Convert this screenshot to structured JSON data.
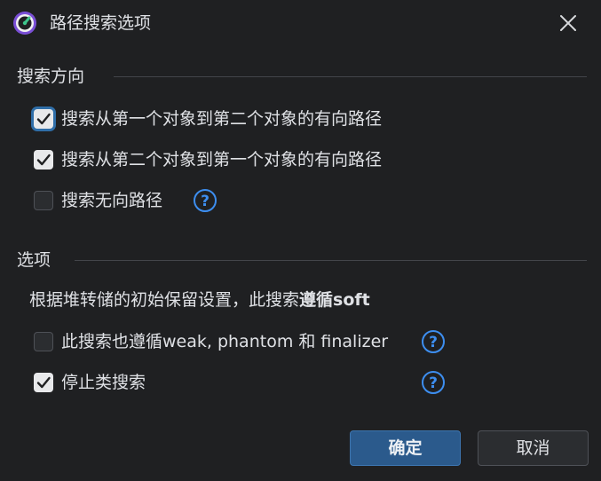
{
  "dialog": {
    "title": "路径搜索选项",
    "close_icon": "close-icon",
    "app_icon": "app-logo-icon"
  },
  "direction": {
    "header": "搜索方向",
    "options": [
      {
        "label": "搜索从第一个对象到第二个对象的有向路径",
        "checked": true,
        "focused": true
      },
      {
        "label": "搜索从第二个对象到第一个对象的有向路径",
        "checked": true
      },
      {
        "label": "搜索无向路径",
        "checked": false,
        "help": true
      }
    ]
  },
  "options": {
    "header": "选项",
    "description_prefix": "根据堆转储的初始保留设置，此搜索",
    "description_bold": "遵循soft",
    "items": [
      {
        "label": "此搜索也遵循weak, phantom 和 finalizer",
        "checked": false,
        "help": true
      },
      {
        "label": "停止类搜索",
        "checked": true,
        "help": true
      }
    ]
  },
  "buttons": {
    "ok": "确定",
    "cancel": "取消"
  },
  "colors": {
    "background": "#1f2022",
    "primary_button": "#2b5a8c",
    "help_icon": "#3d8ef0",
    "focus_ring": "#2f6ea8"
  }
}
